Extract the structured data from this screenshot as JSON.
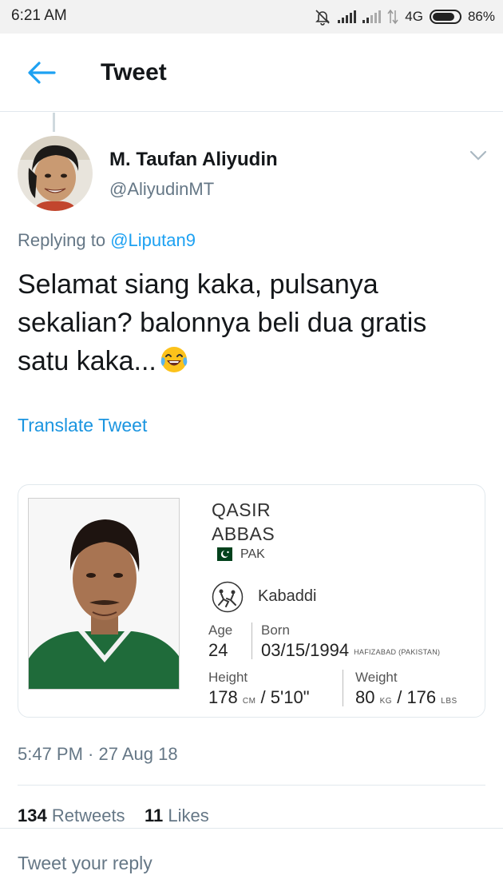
{
  "status_bar": {
    "time": "6:21 AM",
    "network": "4G",
    "battery": "86%",
    "battery_level": 0.86,
    "icons": [
      "mute-bell-icon",
      "signal-icon",
      "data-icon",
      "battery-icon"
    ]
  },
  "header": {
    "title": "Tweet",
    "back_icon": "arrow-left-icon",
    "accent_color": "#1da1f2"
  },
  "tweet": {
    "author_name": "M. Taufan Aliyudin",
    "author_handle": "@AliyudinMT",
    "replying_prefix": "Replying to",
    "replying_mention": "@Liputan9",
    "text_line1": "Selamat siang kaka, pulsanya",
    "text_line2": "sekalian? balonnya beli dua gratis",
    "text_line3": "satu kaka...",
    "emoji": "face-with-tears-of-joy",
    "translate": "Translate Tweet",
    "timestamp": "5:47 PM · 27 Aug 18"
  },
  "athlete_card": {
    "first_name": "QASIR",
    "last_name": "ABBAS",
    "country": "PAK",
    "sport": "Kabaddi",
    "age_label": "Age",
    "age": "24",
    "born_label": "Born",
    "born": "03/15/1994",
    "birthplace": "HAFIZABAD (PAKISTAN)",
    "height_label": "Height",
    "height_cm": "178",
    "height_cm_unit": "CM",
    "height_sep": "/",
    "height_ft": "5'10\"",
    "weight_label": "Weight",
    "weight_kg": "80",
    "weight_kg_unit": "KG",
    "weight_sep": "/",
    "weight_lbs": "176",
    "weight_lbs_unit": "LBS"
  },
  "stats": {
    "retweets_count": "134",
    "retweets_label": "Retweets",
    "likes_count": "11",
    "likes_label": "Likes"
  },
  "reply": {
    "placeholder": "Tweet your reply"
  }
}
